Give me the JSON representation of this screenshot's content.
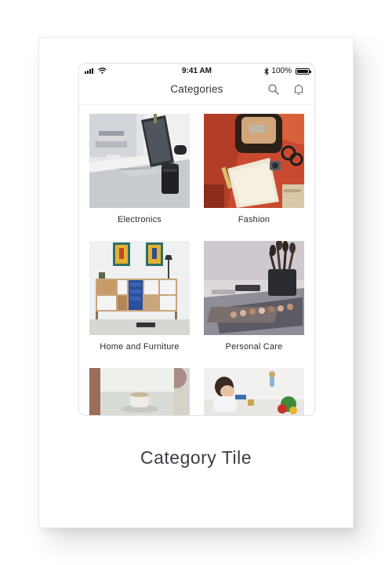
{
  "status_bar": {
    "time": "9:41 AM",
    "battery_percent": "100%",
    "battery_level": 1.0
  },
  "header": {
    "title": "Categories",
    "search_icon": "search-icon",
    "notification_icon": "bell-icon"
  },
  "categories": [
    {
      "label": "Electronics"
    },
    {
      "label": "Fashion"
    },
    {
      "label": "Home and Furniture"
    },
    {
      "label": "Personal Care"
    },
    {
      "label": ""
    },
    {
      "label": ""
    }
  ],
  "caption": "Category Tile",
  "colors": {
    "caption": "#3a3d44",
    "title": "#333333",
    "label": "#2b2b2b",
    "border": "#e2e2e2"
  }
}
